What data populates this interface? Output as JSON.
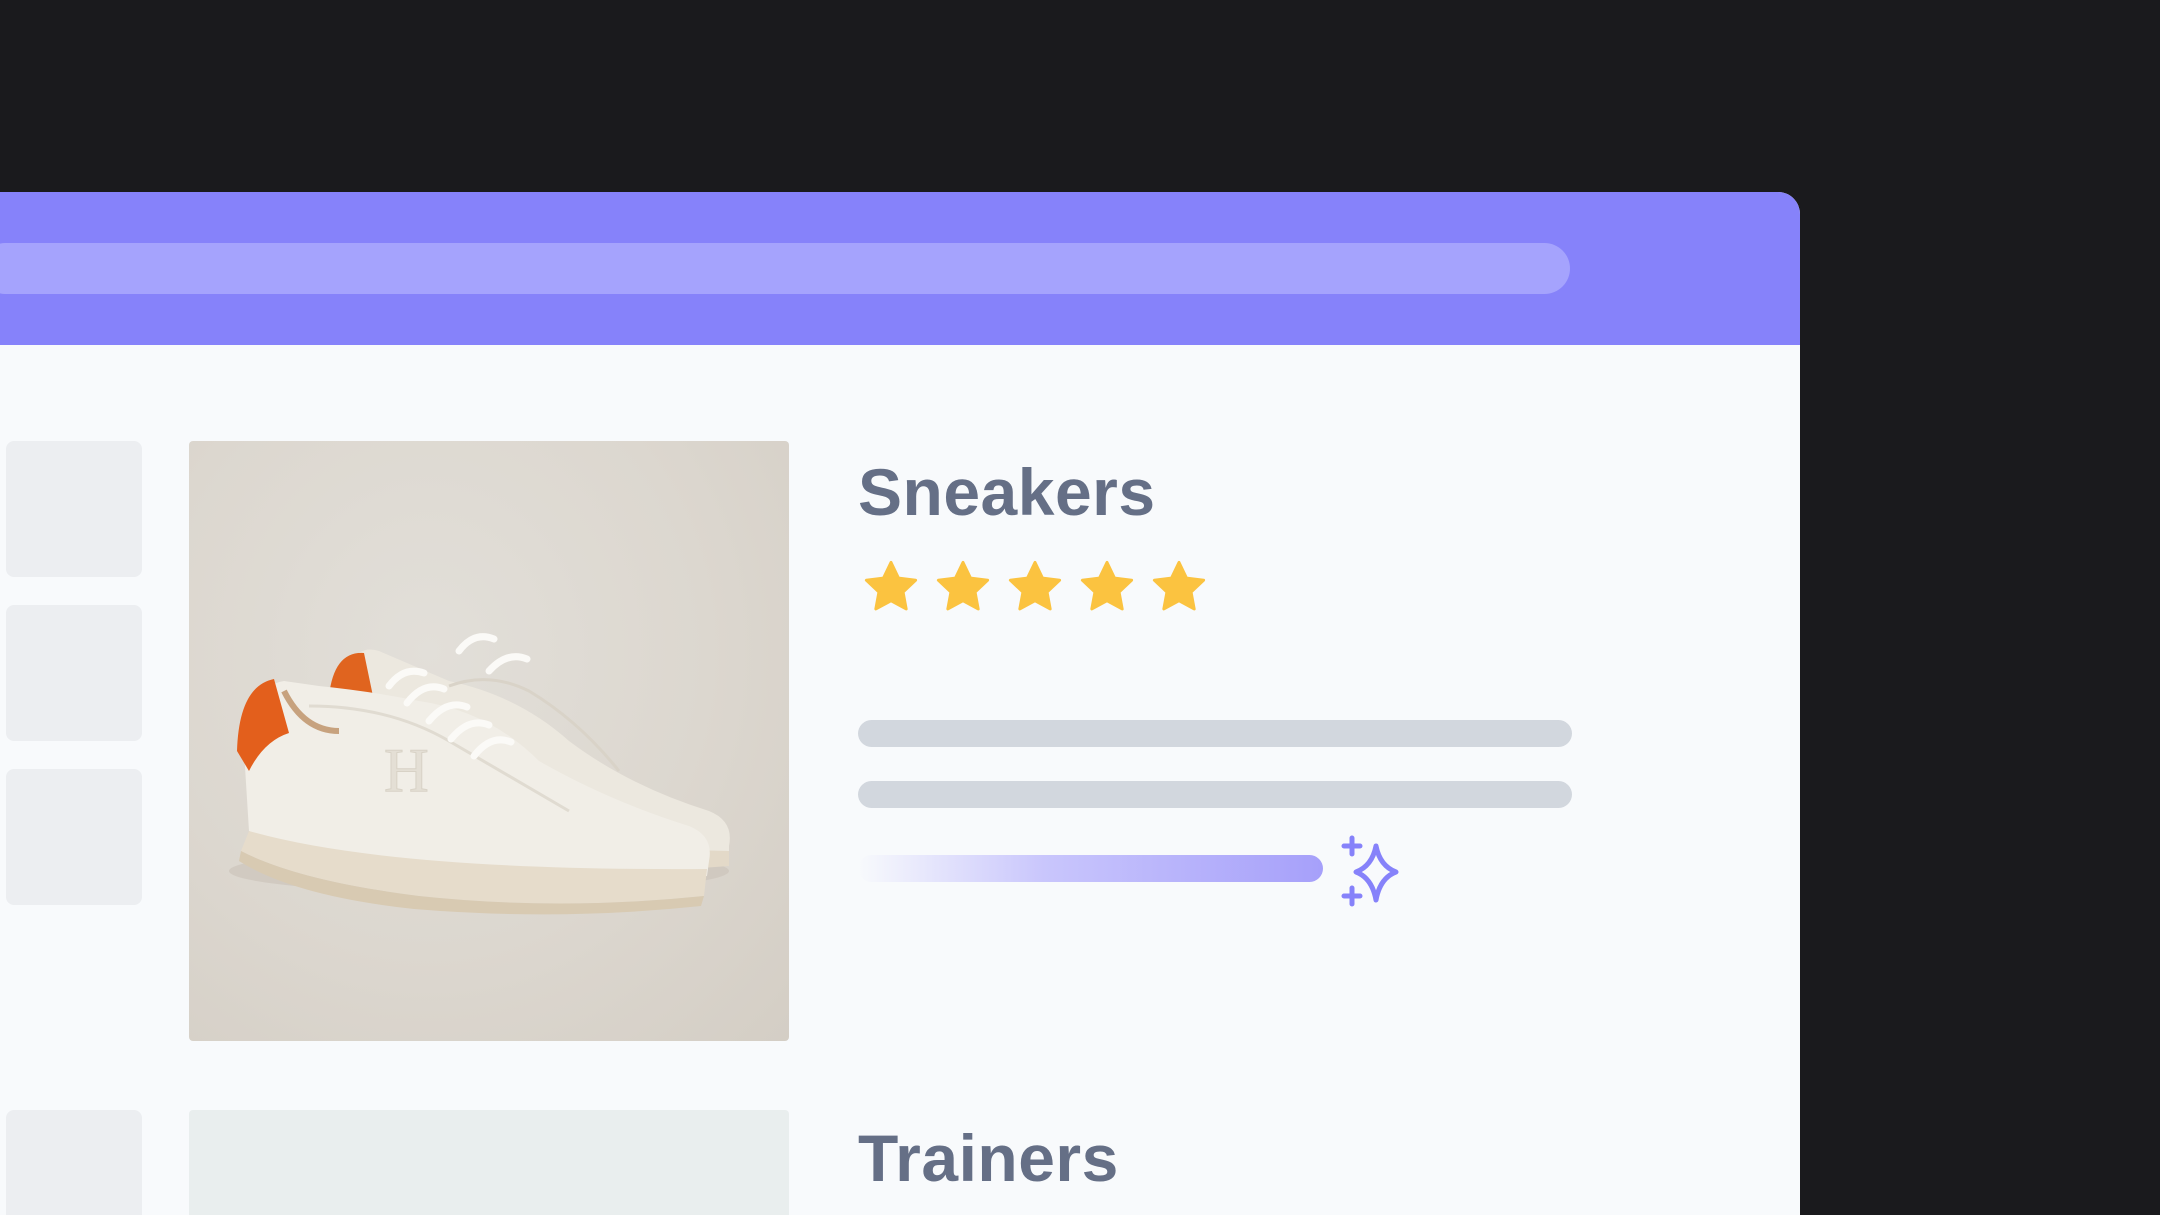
{
  "products": [
    {
      "title": "Sneakers",
      "rating": 5,
      "rating_max": 5
    },
    {
      "title": "Trainers"
    }
  ],
  "colors": {
    "background": "#1a1a1d",
    "topbar": "#8682fa",
    "addressbar": "#a5a3fd",
    "title": "#656f86",
    "star": "#fbc340",
    "skeleton": "#d2d7de",
    "sparkle": "#8682fa"
  },
  "icons": {
    "rating": "star-icon",
    "ai": "sparkle-icon"
  }
}
